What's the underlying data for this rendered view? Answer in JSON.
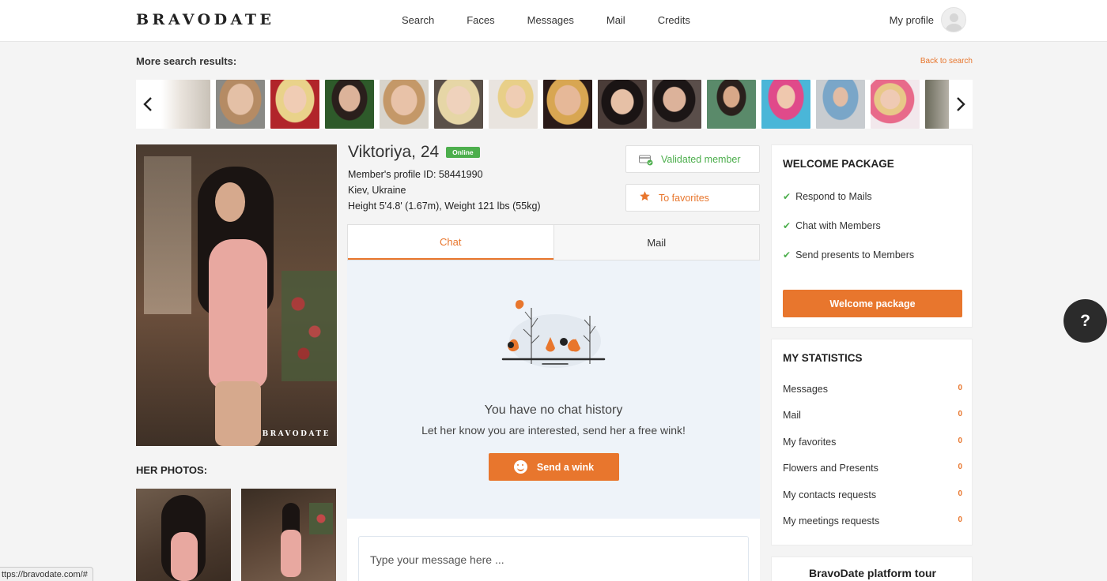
{
  "header": {
    "logo": "BRAVODATE",
    "nav": [
      "Search",
      "Faces",
      "Messages",
      "Mail",
      "Credits"
    ],
    "profile_label": "My profile"
  },
  "results": {
    "label": "More search results:",
    "back_label": "Back to search",
    "prev_icon": "chevron-left-icon",
    "next_icon": "chevron-right-icon"
  },
  "profile": {
    "name": "Viktoriya, 24",
    "status": "Online",
    "profile_id": "Member's profile ID: 58441990",
    "location": "Kiev, Ukraine",
    "physique": "Height 5'4.8' (1.67m), Weight 121 lbs (55kg)",
    "validated_label": "Validated member",
    "favorites_label": "To favorites",
    "photo_watermark": "BRAVODATE",
    "her_photos_label": "HER PHOTOS:"
  },
  "chat": {
    "tabs": [
      "Chat",
      "Mail"
    ],
    "empty_title": "You have no chat history",
    "empty_sub": "Let her know you are interested, send her a free wink!",
    "wink_label": "Send a wink",
    "input_placeholder": "Type your message here ..."
  },
  "welcome": {
    "title": "WELCOME PACKAGE",
    "items": [
      "Respond to Mails",
      "Chat with Members",
      "Send presents to Members"
    ],
    "button_label": "Welcome package"
  },
  "stats": {
    "title": "MY STATISTICS",
    "rows": [
      {
        "label": "Messages",
        "value": "0"
      },
      {
        "label": "Mail",
        "value": "0"
      },
      {
        "label": "My favorites",
        "value": "0"
      },
      {
        "label": "Flowers and Presents",
        "value": "0"
      },
      {
        "label": "My contacts requests",
        "value": "0"
      },
      {
        "label": "My meetings requests",
        "value": "0"
      }
    ]
  },
  "tour": {
    "title": "BravoDate platform tour"
  },
  "help_label": "?",
  "status_url": "ttps://bravodate.com/#",
  "colors": {
    "accent": "#e8762d",
    "online": "#4cae4c"
  }
}
